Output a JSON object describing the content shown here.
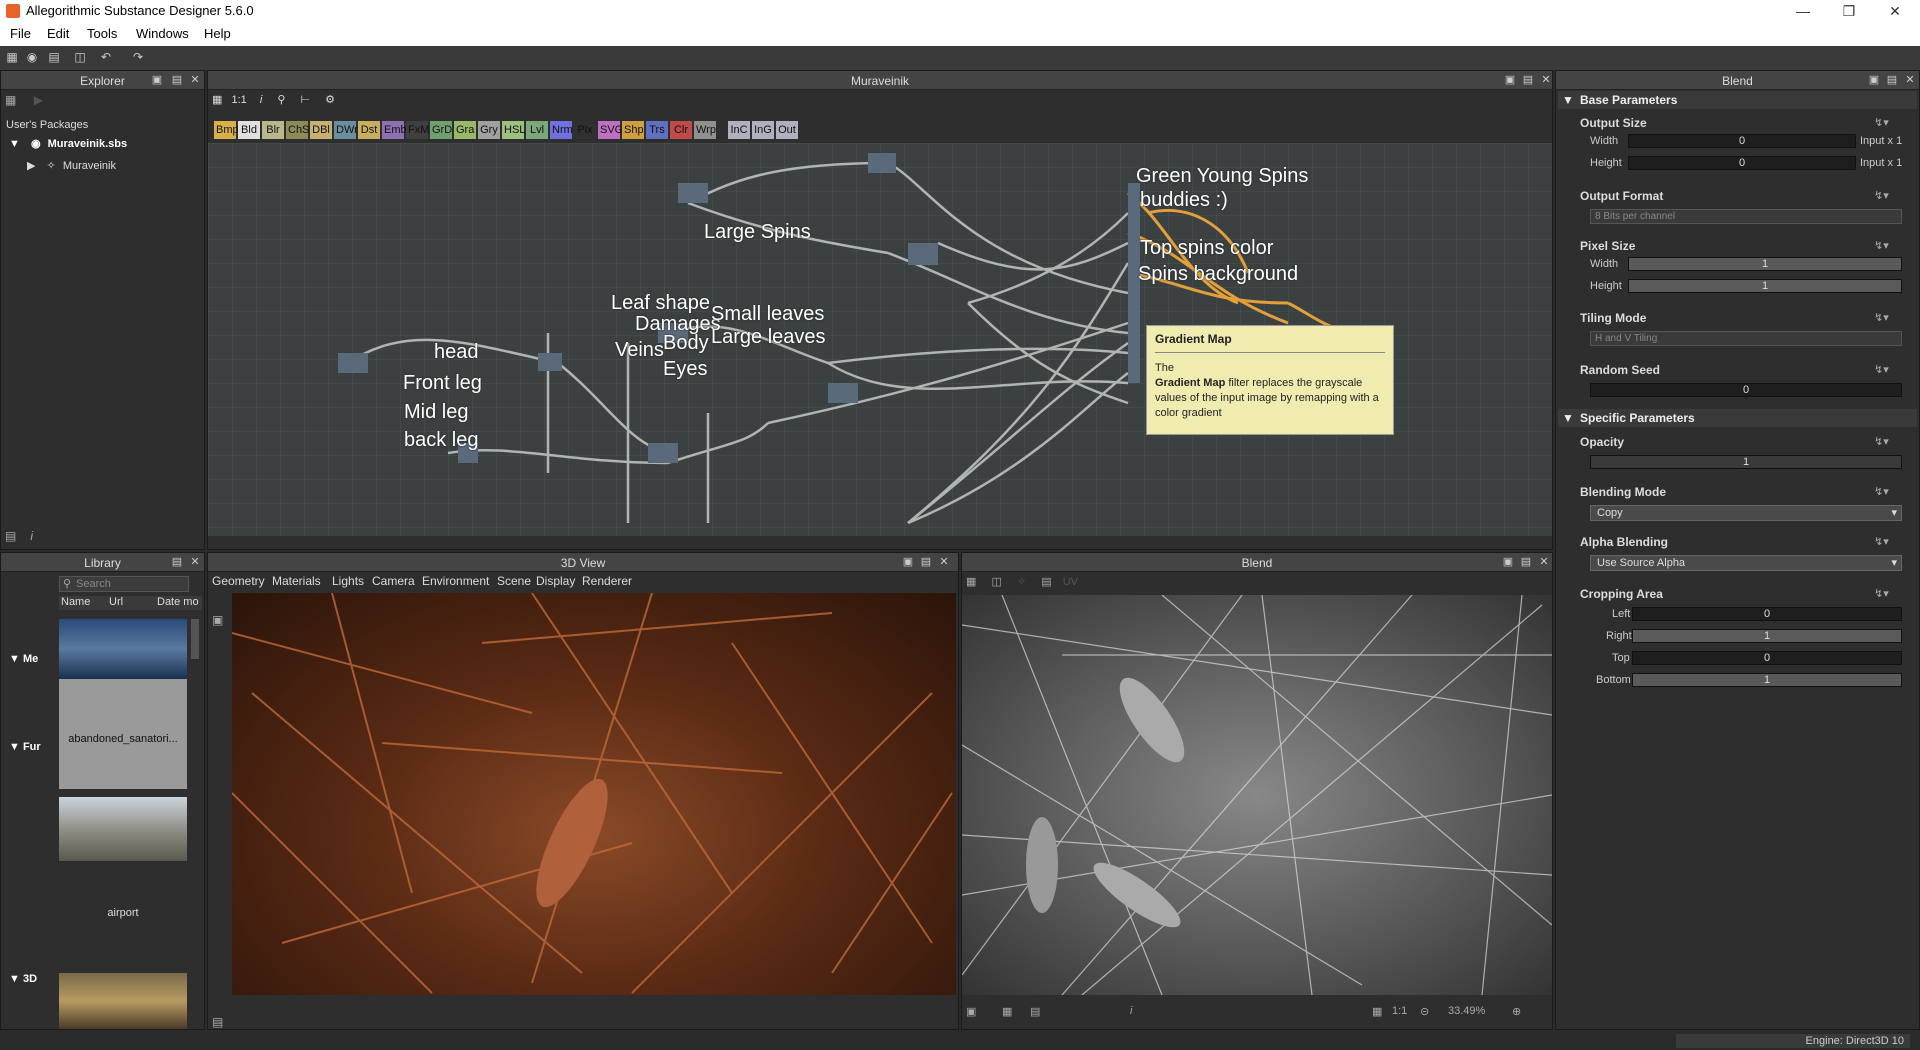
{
  "window": {
    "title": "Allegorithmic Substance Designer 5.6.0"
  },
  "menu": [
    "File",
    "Edit",
    "Tools",
    "Windows",
    "Help"
  ],
  "explorer": {
    "title": "Explorer",
    "root": "User's Packages",
    "package": "Muraveinik.sbs",
    "graph": "Muraveinik"
  },
  "graph_panel": {
    "title": "Muraveinik",
    "zoom": "1:1",
    "chips": [
      {
        "label": "Bmp",
        "color": "#d8b04a"
      },
      {
        "label": "Bld",
        "color": "#e0e0e0"
      },
      {
        "label": "Blr",
        "color": "#b8b88c"
      },
      {
        "label": "ChS",
        "color": "#8c8c5a"
      },
      {
        "label": "DBl",
        "color": "#c8b070"
      },
      {
        "label": "DWr",
        "color": "#6a90a0"
      },
      {
        "label": "Dst",
        "color": "#c6b060"
      },
      {
        "label": "Emb",
        "color": "#8c70b0"
      },
      {
        "label": "FxM",
        "color": "#404040"
      },
      {
        "label": "GrD",
        "color": "#70a070"
      },
      {
        "label": "Gra",
        "color": "#9ab86a"
      },
      {
        "label": "Gry",
        "color": "#a0a0a0"
      },
      {
        "label": "HSL",
        "color": "#9cc080"
      },
      {
        "label": "Lvl",
        "color": "#7aa87a"
      },
      {
        "label": "Nrm",
        "color": "#7070e0"
      },
      {
        "label": "Plx",
        "color": "#303030"
      },
      {
        "label": "SVG",
        "color": "#c070c0"
      },
      {
        "label": "Shp",
        "color": "#d0a040"
      },
      {
        "label": "Trs",
        "color": "#6070c0"
      },
      {
        "label": "Clr",
        "color": "#c04a4a"
      },
      {
        "label": "Wrp",
        "color": "#909090"
      },
      {
        "label": "InC",
        "color": "#b0b0c0"
      },
      {
        "label": "InG",
        "color": "#b0b0c0"
      },
      {
        "label": "Out",
        "color": "#b0b0c0"
      }
    ],
    "frame_labels": [
      "Green Young Spins",
      "buddies :)",
      "Top spins color",
      "Spins background",
      "Large Spins",
      "Leaf shape",
      "Damages",
      "Body",
      "Veins",
      "Eyes",
      "Small leaves",
      "Large leaves",
      "head",
      "Front leg",
      "Mid leg",
      "back leg"
    ],
    "tooltip": {
      "title": "Gradient Map",
      "line1": "The",
      "bold": "Gradient Map",
      "rest": " filter replaces the grayscale values of the input image by remapping with a color gradient"
    }
  },
  "library": {
    "title": "Library",
    "search_placeholder": "Search",
    "columns": [
      "Name",
      "Url",
      "Date mo"
    ],
    "categories": [
      "Me",
      "Fur",
      "3D"
    ],
    "items": [
      {
        "name": "abandoned_sanatori..."
      },
      {
        "name": "airport"
      }
    ]
  },
  "view3d": {
    "title": "3D View",
    "menu": [
      "Geometry",
      "Materials",
      "Lights",
      "Camera",
      "Environment",
      "Scene",
      "Display",
      "Renderer"
    ]
  },
  "view2d": {
    "title": "Blend",
    "uv": "UV",
    "ratio": "1:1",
    "zoom": "33.49%"
  },
  "properties": {
    "title": "Blend",
    "base_section": "Base Parameters",
    "output_size": {
      "title": "Output Size",
      "width_label": "Width",
      "width_value": "0",
      "width_note": "Input x 1",
      "height_label": "Height",
      "height_value": "0",
      "height_note": "Input x 1"
    },
    "output_format": {
      "title": "Output Format",
      "value": "8 Bits per channel"
    },
    "pixel_size": {
      "title": "Pixel Size",
      "width_label": "Width",
      "width_value": "1",
      "height_label": "Height",
      "height_value": "1"
    },
    "tiling_mode": {
      "title": "Tiling Mode",
      "value": "H and V Tiling"
    },
    "random_seed": {
      "title": "Random Seed",
      "value": "0"
    },
    "specific_section": "Specific Parameters",
    "opacity": {
      "title": "Opacity",
      "value": "1"
    },
    "blending_mode": {
      "title": "Blending Mode",
      "value": "Copy"
    },
    "alpha_blending": {
      "title": "Alpha Blending",
      "value": "Use Source Alpha"
    },
    "cropping": {
      "title": "Cropping Area",
      "left_label": "Left",
      "left": "0",
      "right_label": "Right",
      "right": "1",
      "top_label": "Top",
      "top": "0",
      "bottom_label": "Bottom",
      "bottom": "1"
    }
  },
  "status": {
    "engine": "Engine: Direct3D 10"
  }
}
